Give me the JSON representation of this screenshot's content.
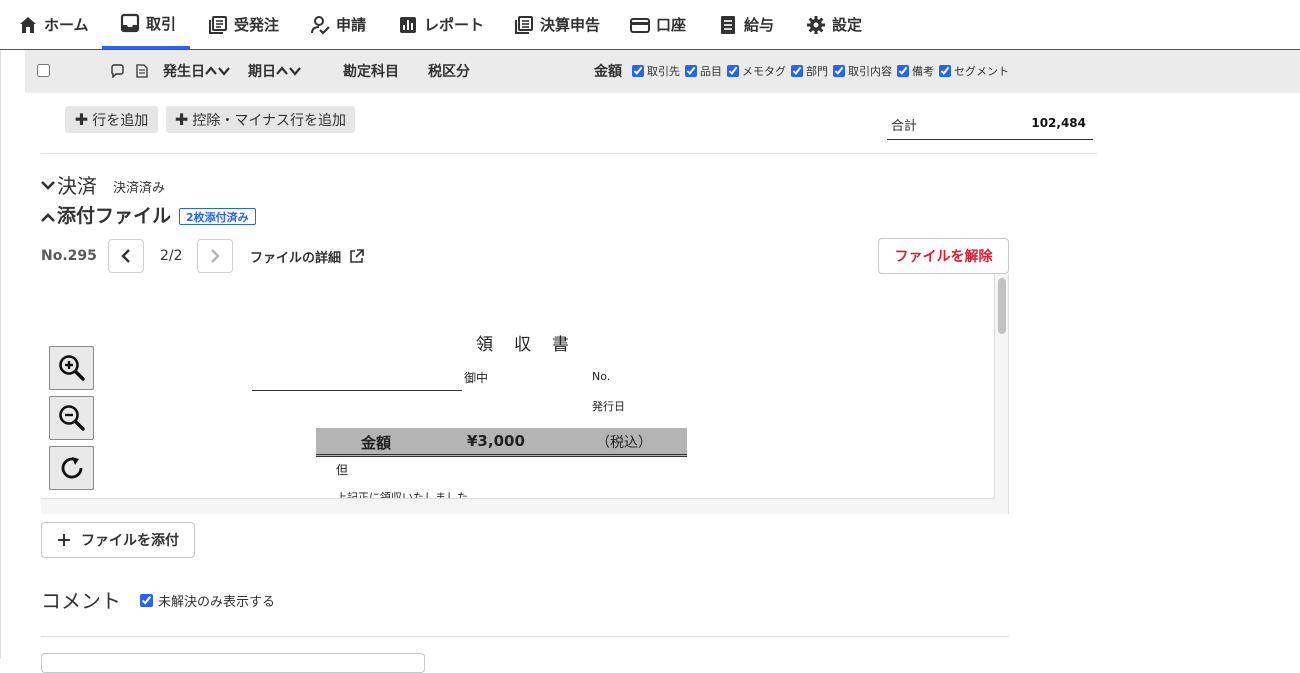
{
  "nav": {
    "items": [
      {
        "label": "ホーム",
        "icon": "home-icon"
      },
      {
        "label": "取引",
        "icon": "inbox-icon",
        "active": true
      },
      {
        "label": "受発注",
        "icon": "orders-icon"
      },
      {
        "label": "申請",
        "icon": "person-check-icon"
      },
      {
        "label": "レポート",
        "icon": "chart-icon"
      },
      {
        "label": "決算申告",
        "icon": "document-icon"
      },
      {
        "label": "口座",
        "icon": "card-icon"
      },
      {
        "label": "給与",
        "icon": "payroll-icon"
      },
      {
        "label": "設定",
        "icon": "gear-icon"
      }
    ]
  },
  "table_header": {
    "issue_date": "発生日",
    "due_date": "期日",
    "account": "勘定科目",
    "tax": "税区分",
    "amount": "金額",
    "toggles": [
      {
        "label": "取引先",
        "checked": true
      },
      {
        "label": "品目",
        "checked": true
      },
      {
        "label": "メモタグ",
        "checked": true
      },
      {
        "label": "部門",
        "checked": true
      },
      {
        "label": "取引内容",
        "checked": true
      },
      {
        "label": "備考",
        "checked": true
      },
      {
        "label": "セグメント",
        "checked": true
      }
    ]
  },
  "actions": {
    "add_row": "行を追加",
    "add_deduction_row": "控除・マイナス行を追加"
  },
  "total": {
    "label": "合計",
    "value": "102,484"
  },
  "settlement": {
    "title": "決済",
    "status": "決済済み"
  },
  "attachments": {
    "title": "添付ファイル",
    "badge": "2枚添付済み",
    "number": "No.295",
    "page": "2/2",
    "details": "ファイルの詳細",
    "detach": "ファイルを解除",
    "attach": "ファイルを添付"
  },
  "receipt": {
    "title": "領　収　書",
    "to_suffix": "御中",
    "no": "No.",
    "issue_date": "発行日",
    "amount_label": "金額",
    "amount_value": "¥3,000",
    "tax_note": "（税込）",
    "proviso": "但",
    "received_text": "上記正に領収いたしました"
  },
  "comments": {
    "title": "コメント",
    "unresolved_only": "未解決のみ表示する",
    "unresolved_checked": true
  }
}
